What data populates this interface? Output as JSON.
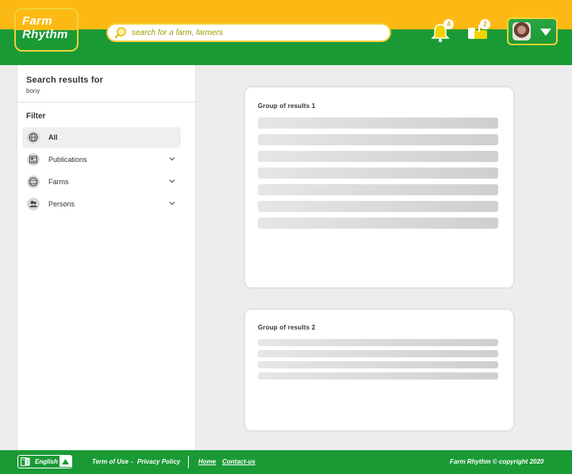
{
  "brand": {
    "line1": "Farm",
    "line2": "Rhythm"
  },
  "search": {
    "placeholder": "search for a farm, farmers"
  },
  "notifications": {
    "bell_count": "4",
    "mail_count": "2"
  },
  "sidebar": {
    "title": "Search results for",
    "query": "bony",
    "filter_label": "Filter",
    "items": [
      {
        "label": "All"
      },
      {
        "label": "Publications"
      },
      {
        "label": "Farms"
      },
      {
        "label": "Persons"
      }
    ]
  },
  "results": [
    {
      "title": "Group of results 1"
    },
    {
      "title": "Group of results 2"
    }
  ],
  "footer": {
    "language": "English",
    "terms": "Term of Use",
    "dash": "-",
    "privacy": "Privacy Policy",
    "home": "Home",
    "contact": "Contact-us",
    "copyright": "Farm Rhythm © copyright 2020"
  },
  "colors": {
    "yellow": "#fdb913",
    "green": "#1a9a35"
  }
}
